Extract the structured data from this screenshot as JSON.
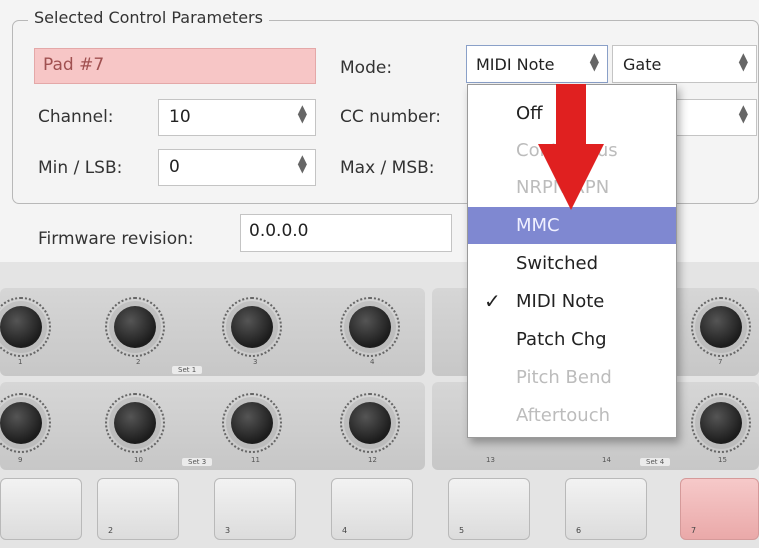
{
  "group": {
    "legend": "Selected Control Parameters"
  },
  "pad_name": {
    "value": "Pad #7"
  },
  "mode": {
    "label": "Mode:",
    "value": "MIDI Note",
    "option_value": "Gate"
  },
  "channel": {
    "label": "Channel:",
    "value": "10"
  },
  "cc": {
    "label": "CC number:"
  },
  "min": {
    "label": "Min / LSB:",
    "value": "0"
  },
  "max": {
    "label": "Max / MSB:"
  },
  "firmware": {
    "label": "Firmware revision:",
    "value": "0.0.0.0"
  },
  "menu": {
    "items": [
      {
        "label": "Off",
        "state": "enabled"
      },
      {
        "label": "Continuous",
        "state": "disabled"
      },
      {
        "label": "NRPN/RPN",
        "state": "disabled"
      },
      {
        "label": "MMC",
        "state": "highlighted"
      },
      {
        "label": "Switched",
        "state": "enabled"
      },
      {
        "label": "MIDI Note",
        "state": "checked"
      },
      {
        "label": "Patch Chg",
        "state": "enabled"
      },
      {
        "label": "Pitch Bend",
        "state": "disabled"
      },
      {
        "label": "Aftertouch",
        "state": "disabled"
      }
    ]
  },
  "annotation": {
    "arrow_color": "#e02020"
  },
  "device": {
    "knob_labels_row1": [
      "1",
      "2",
      "3",
      "4",
      "",
      "",
      "7"
    ],
    "knob_labels_row2": [
      "9",
      "10",
      "11",
      "12",
      "13",
      "14",
      "15"
    ],
    "set_tags": [
      "Set 1",
      "Set 3",
      "Set 4"
    ],
    "pads": [
      "",
      "2",
      "3",
      "4",
      "5",
      "6",
      "7"
    ],
    "active_pad_color": "#eaa9a9"
  }
}
